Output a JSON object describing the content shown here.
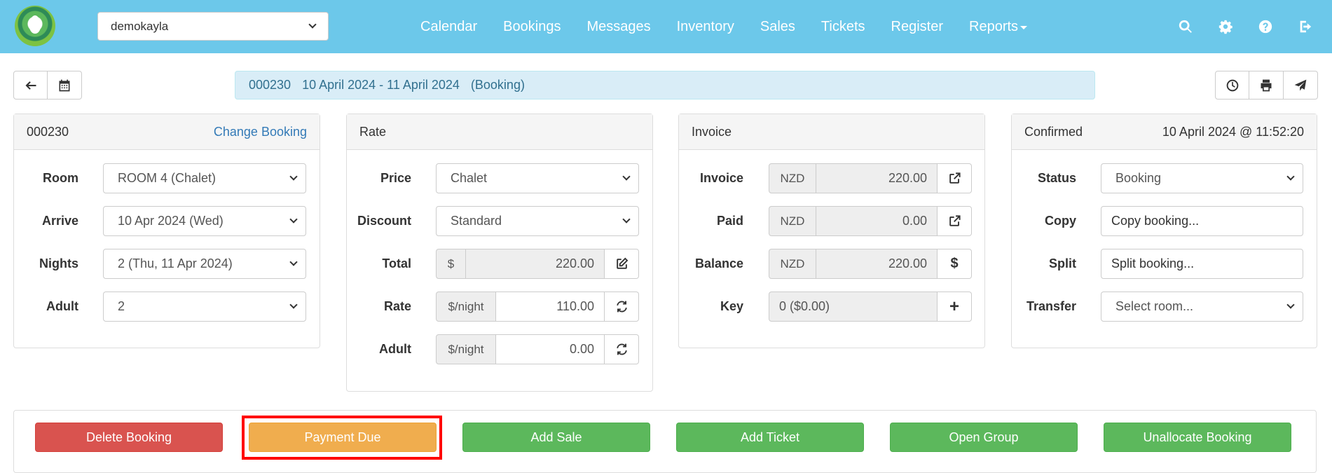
{
  "nav": {
    "property": "demokayla",
    "links": [
      "Calendar",
      "Bookings",
      "Messages",
      "Inventory",
      "Sales",
      "Tickets",
      "Register",
      "Reports"
    ]
  },
  "banner": {
    "number": "000230",
    "dates": "10 April 2024 - 11 April 2024",
    "type": "(Booking)"
  },
  "booking_panel": {
    "title": "000230",
    "change_link": "Change Booking",
    "room_label": "Room",
    "room_value": "ROOM 4 (Chalet)",
    "arrive_label": "Arrive",
    "arrive_value": "10 Apr 2024 (Wed)",
    "nights_label": "Nights",
    "nights_value": "2  (Thu, 11 Apr 2024)",
    "adult_label": "Adult",
    "adult_value": "2"
  },
  "rate_panel": {
    "title": "Rate",
    "price_label": "Price",
    "price_value": "Chalet",
    "discount_label": "Discount",
    "discount_value": "Standard",
    "total_label": "Total",
    "total_unit": "$",
    "total_value": "220.00",
    "rate_label": "Rate",
    "rate_unit": "$/night",
    "rate_value": "110.00",
    "adult_label": "Adult",
    "adult_unit": "$/night",
    "adult_value": "0.00"
  },
  "invoice_panel": {
    "title": "Invoice",
    "invoice_label": "Invoice",
    "invoice_currency": "NZD",
    "invoice_value": "220.00",
    "paid_label": "Paid",
    "paid_currency": "NZD",
    "paid_value": "0.00",
    "balance_label": "Balance",
    "balance_currency": "NZD",
    "balance_value": "220.00",
    "balance_btn": "$",
    "key_label": "Key",
    "key_value": "0 ($0.00)",
    "key_btn": "+"
  },
  "status_panel": {
    "title": "Confirmed",
    "timestamp": "10 April 2024 @ 11:52:20",
    "status_label": "Status",
    "status_value": "Booking",
    "copy_label": "Copy",
    "copy_value": "Copy booking...",
    "split_label": "Split",
    "split_value": "Split booking...",
    "transfer_label": "Transfer",
    "transfer_value": "Select room..."
  },
  "actions": {
    "delete": "Delete Booking",
    "payment_due": "Payment Due",
    "add_sale": "Add Sale",
    "add_ticket": "Add Ticket",
    "open_group": "Open Group",
    "unallocate": "Unallocate Booking"
  },
  "colors": {
    "navbar": "#6cc8ea",
    "danger": "#d9534f",
    "warning": "#f0ad4e",
    "success": "#5cb85c",
    "highlight": "#ff0000"
  }
}
